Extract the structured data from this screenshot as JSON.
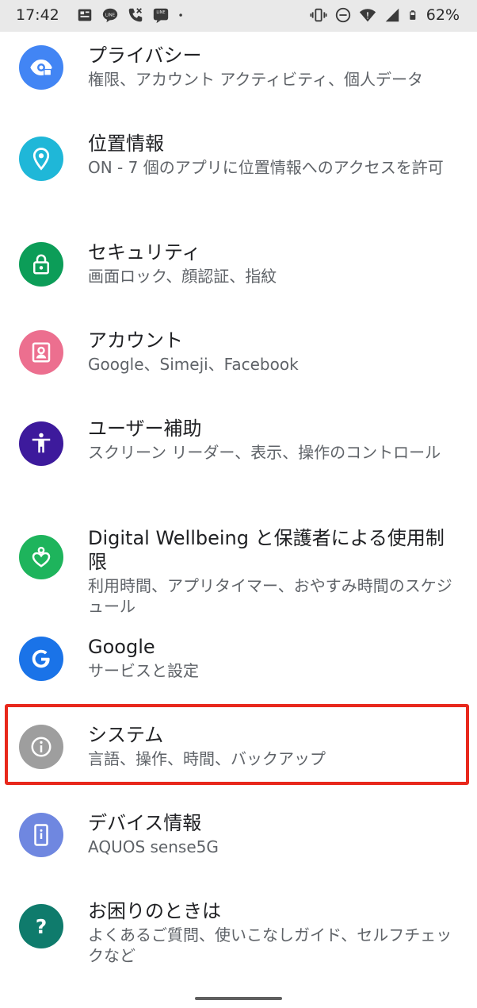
{
  "status_bar": {
    "time": "17:42",
    "battery": "62%",
    "left_icons": [
      "news-icon",
      "line-icon",
      "missed-call-icon",
      "line-manga-icon",
      "dot-icon"
    ],
    "right_icons": [
      "vibrate-icon",
      "do-not-disturb-icon",
      "wifi-icon",
      "cell-signal-icon",
      "battery-icon"
    ]
  },
  "settings": [
    {
      "title": "プライバシー",
      "subtitle": "権限、アカウント アクティビティ、個人データ",
      "icon": "privacy-eye-icon",
      "color": "#4285f4"
    },
    {
      "title": "位置情報",
      "subtitle": "ON - 7 個のアプリに位置情報へのアクセスを許可",
      "icon": "location-pin-icon",
      "color": "#1fb7d8"
    },
    {
      "title": "セキュリティ",
      "subtitle": "画面ロック、顔認証、指紋",
      "icon": "lock-icon",
      "color": "#0c9d58"
    },
    {
      "title": "アカウント",
      "subtitle": "Google、Simeji、Facebook",
      "icon": "account-icon",
      "color": "#ec6f8f"
    },
    {
      "title": "ユーザー補助",
      "subtitle": "スクリーン リーダー、表示、操作のコントロール",
      "icon": "accessibility-icon",
      "color": "#3d1a9c"
    },
    {
      "title": "Digital Wellbeing と保護者による使用制限",
      "subtitle": "利用時間、アプリタイマー、おやすみ時間のスケジュール",
      "icon": "wellbeing-heart-icon",
      "color": "#1eb45c"
    },
    {
      "title": "Google",
      "subtitle": "サービスと設定",
      "icon": "google-icon",
      "color": "#1a73e8"
    },
    {
      "title": "システム",
      "subtitle": "言語、操作、時間、バックアップ",
      "icon": "info-icon",
      "color": "#9e9e9e"
    },
    {
      "title": "デバイス情報",
      "subtitle": "AQUOS sense5G",
      "icon": "device-icon",
      "color": "#6f87e0"
    },
    {
      "title": "お困りのときは",
      "subtitle": "よくあるご質問、使いこなしガイド、セルフチェックなど",
      "icon": "help-icon",
      "color": "#0f7b6c"
    }
  ],
  "highlight_color": "#e8281c"
}
